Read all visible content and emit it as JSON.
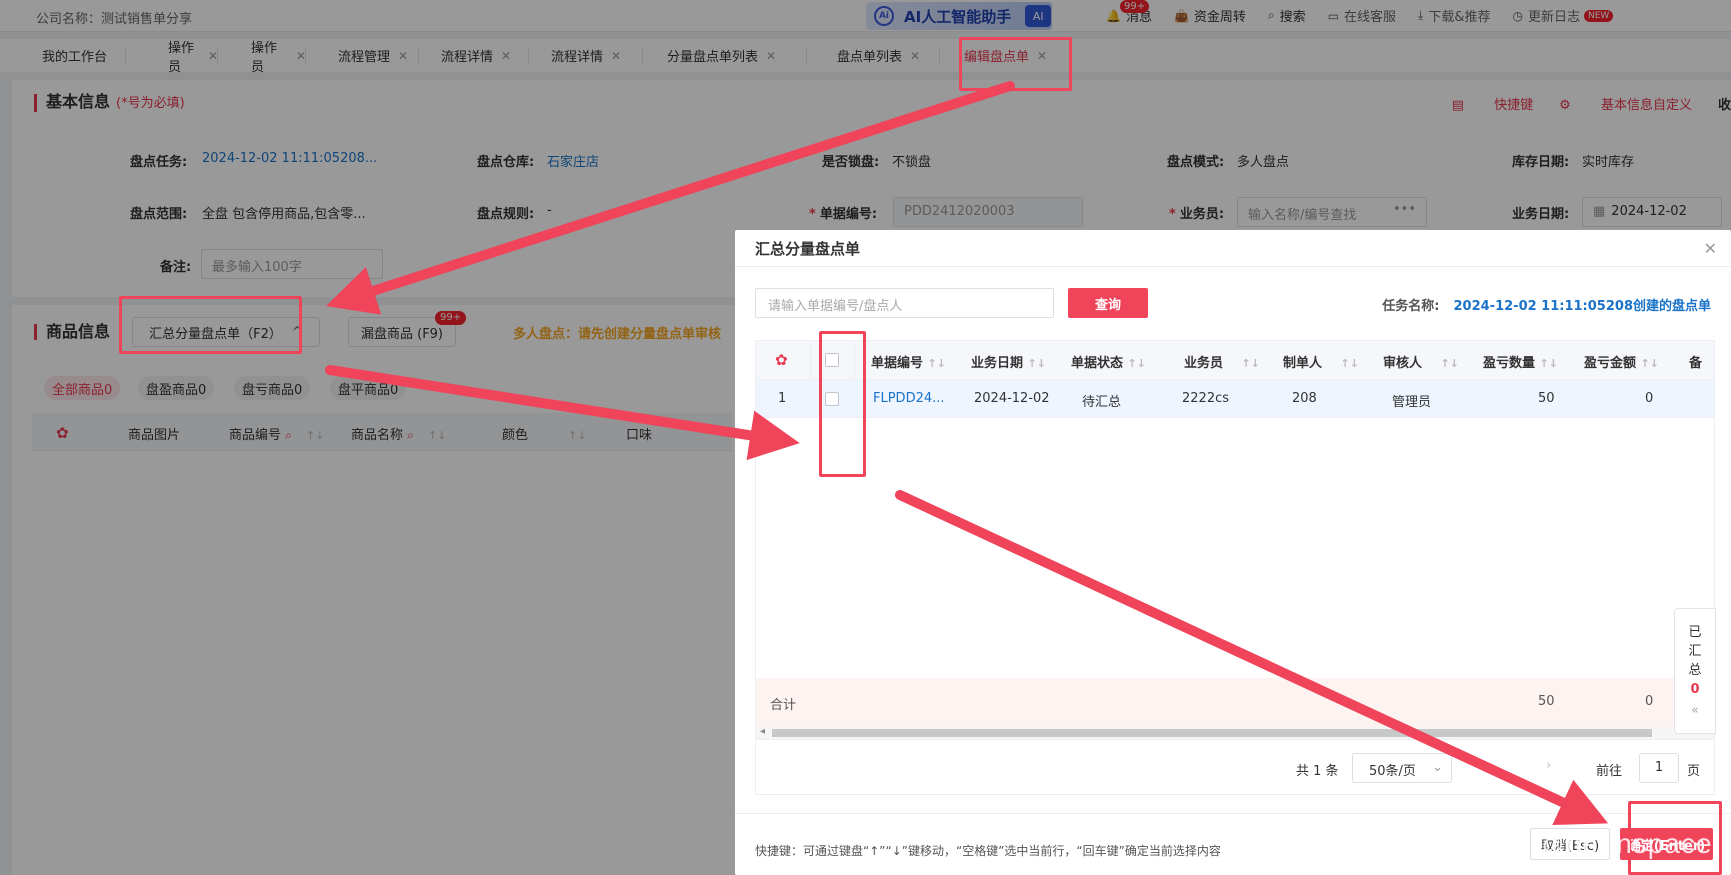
{
  "topbar": {
    "company": "公司名称：测试销售单分享",
    "ai_logo": "Ai",
    "ai_text": "AI人工智能助手",
    "ai_badge": "AI",
    "links": [
      {
        "icon": "bell-icon",
        "label": "消息",
        "badge": "99+"
      },
      {
        "icon": "money-bag-icon",
        "label": "资金周转"
      },
      {
        "icon": "search-icon",
        "label": "搜索"
      },
      {
        "icon": "chat-icon",
        "label": "在线客服"
      },
      {
        "icon": "download-icon",
        "label": "下载&推荐"
      },
      {
        "icon": "clock-icon",
        "label": "更新日志",
        "badge": "NEW"
      }
    ]
  },
  "tabs": [
    {
      "label": "我的工作台",
      "closable": false
    },
    {
      "label": "操作员",
      "closable": true
    },
    {
      "label": "操作员",
      "closable": true
    },
    {
      "label": "流程管理",
      "closable": true
    },
    {
      "label": "流程详情",
      "closable": true
    },
    {
      "label": "流程详情",
      "closable": true
    },
    {
      "label": "分量盘点单列表",
      "closable": true
    },
    {
      "label": "盘点单列表",
      "closable": true
    },
    {
      "label": "编辑盘点单",
      "closable": true,
      "active": true
    }
  ],
  "basic": {
    "title": "基本信息",
    "required_note": "(*号为必填)",
    "shortcut_link": "快捷键",
    "custom_link": "基本信息自定义",
    "collapse_link": "收",
    "fields": {
      "task_label": "盘点任务:",
      "task_value": "2024-12-02 11:11:05208...",
      "warehouse_label": "盘点仓库:",
      "warehouse_value": "石家庄店",
      "lock_label": "是否锁盘:",
      "lock_value": "不锁盘",
      "mode_label": "盘点模式:",
      "mode_value": "多人盘点",
      "stockdate_label": "库存日期:",
      "stockdate_value": "实时库存",
      "scope_label": "盘点范围:",
      "scope_value": "全盘 包含停用商品,包含零...",
      "rule_label": "盘点规则:",
      "rule_value": "-",
      "docno_label": "单据编号:",
      "docno_value": "PDD2412020003",
      "staff_label": "业务员:",
      "staff_placeholder": "输入名称/编号查找",
      "bizdate_label": "业务日期:",
      "bizdate_value": "2024-12-02",
      "remark_label": "备注:",
      "remark_placeholder": "最多输入100字"
    }
  },
  "goods": {
    "title": "商品信息",
    "merge_btn": "汇总分量盘点单（F2）",
    "missing_btn": "漏盘商品 (F9)",
    "missing_badge": "99+",
    "warning": "多人盘点：请先创建分量盘点单审核",
    "filters": [
      "全部商品0",
      "盘盈商品0",
      "盘亏商品0",
      "盘平商品0"
    ],
    "columns": [
      "商品图片",
      "商品编号",
      "商品名称",
      "颜色",
      "口味"
    ]
  },
  "modal": {
    "title": "汇总分量盘点单",
    "search_placeholder": "请输入单据编号/盘点人",
    "query_btn": "查询",
    "task_label": "任务名称:",
    "task_value": "2024-12-02 11:11:05208创建的盘点单",
    "columns": [
      "单据编号",
      "业务日期",
      "单据状态",
      "业务员",
      "制单人",
      "审核人",
      "盈亏数量",
      "盈亏金额",
      "备"
    ],
    "rows": [
      {
        "idx": "1",
        "doc": "FLPDD24...",
        "date": "2024-12-02",
        "status": "待汇总",
        "staff": "2222cs",
        "maker": "208",
        "auditor": "管理员",
        "qty": "50",
        "amount": "0"
      }
    ],
    "sum_label": "合计",
    "sum_qty": "50",
    "sum_amount": "0",
    "pager": {
      "total": "共 1 条",
      "size": "50条/页",
      "goto": "前往",
      "page": "1",
      "page_unit": "页"
    },
    "hint": "快捷键：可通过键盘“↑”“↓”键移动，“空格键”选中当前行，“回车键”确定当前选择内容",
    "cancel_btn": "取消(Esc)",
    "ok_btn": "确定(Enter)"
  },
  "side_float": {
    "chars": [
      "已",
      "汇",
      "总"
    ],
    "count": "0"
  },
  "watermark": "CSDN @herinspace",
  "colors": {
    "accent": "#f0445b",
    "link": "#1a73c9",
    "annotation": "#f0445b"
  }
}
